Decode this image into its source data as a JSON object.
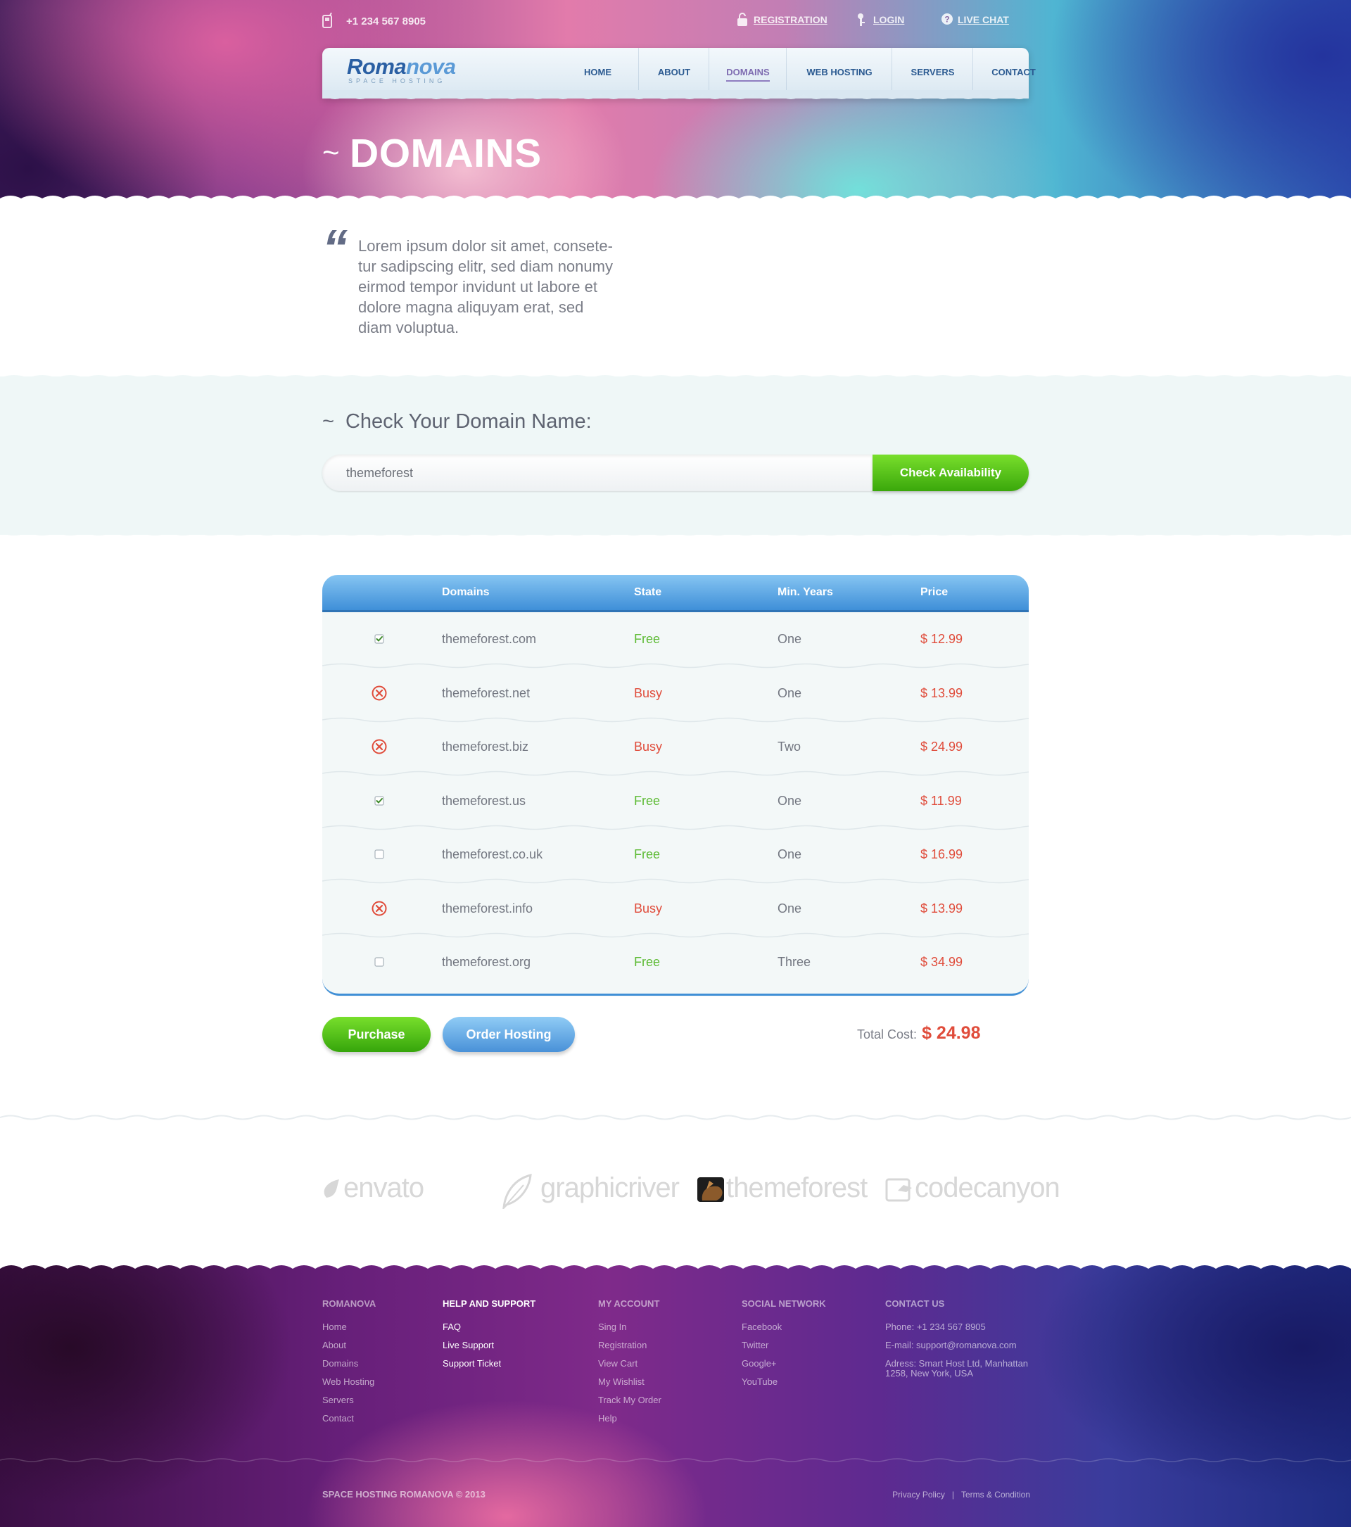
{
  "topbar": {
    "phone": "+1 234 567 8905",
    "links": [
      {
        "label": "REGISTRATION",
        "icon": "lock-icon"
      },
      {
        "label": "LOGIN",
        "icon": "key-icon"
      },
      {
        "label": "LIVE CHAT",
        "icon": "question-icon"
      }
    ]
  },
  "logo": {
    "main_a": "Roma",
    "main_b": "nova",
    "sub": "SPACE HOSTING"
  },
  "nav": [
    "HOME",
    "ABOUT",
    "DOMAINS",
    "WEB HOSTING",
    "SERVERS",
    "CONTACT"
  ],
  "nav_active": "DOMAINS",
  "page": {
    "tilde": "~",
    "title": "DOMAINS"
  },
  "intro": "Lorem ipsum dolor sit amet, consete-tur sadipscing elitr, sed diam nonumy eirmod tempor invidunt ut labore et dolore magna aliquyam erat, sed diam voluptua.",
  "search": {
    "title": "Check Your Domain Name:",
    "value": "themeforest",
    "button": "Check Availability"
  },
  "table": {
    "headers": [
      "Domains",
      "State",
      "Min. Years",
      "Price"
    ],
    "rows": [
      {
        "mark": "checked",
        "domain": "themeforest.com",
        "state": "Free",
        "years": "One",
        "price": "$ 12.99"
      },
      {
        "mark": "busy",
        "domain": "themeforest.net",
        "state": "Busy",
        "years": "One",
        "price": "$ 13.99"
      },
      {
        "mark": "busy",
        "domain": "themeforest.biz",
        "state": "Busy",
        "years": "Two",
        "price": "$ 24.99"
      },
      {
        "mark": "checked",
        "domain": "themeforest.us",
        "state": "Free",
        "years": "One",
        "price": "$ 11.99"
      },
      {
        "mark": "unchecked",
        "domain": "themeforest.co.uk",
        "state": "Free",
        "years": "One",
        "price": "$ 16.99"
      },
      {
        "mark": "busy",
        "domain": "themeforest.info",
        "state": "Busy",
        "years": "One",
        "price": "$ 13.99"
      },
      {
        "mark": "unchecked",
        "domain": "themeforest.org",
        "state": "Free",
        "years": "Three",
        "price": "$ 34.99"
      }
    ]
  },
  "actions": {
    "purchase": "Purchase",
    "order": "Order Hosting",
    "total_label": "Total Cost:",
    "total_value": "$ 24.98"
  },
  "partners": [
    "envato",
    "graphicriver",
    "themeforest",
    "codecanyon"
  ],
  "footer": {
    "columns": [
      {
        "title": "ROMANOVA",
        "links": [
          "Home",
          "About",
          "Domains",
          "Web Hosting",
          "Servers",
          "Contact"
        ]
      },
      {
        "title": "HELP AND SUPPORT",
        "links": [
          "FAQ",
          "Live Support",
          "Support Ticket"
        ]
      },
      {
        "title": "MY ACCOUNT",
        "links": [
          "Sing In",
          "Registration",
          "View Cart",
          "My Wishlist",
          "Track My Order",
          "Help"
        ]
      },
      {
        "title": "SOCIAL NETWORK",
        "links": [
          "Facebook",
          "Twitter",
          "Google+",
          "YouTube"
        ]
      },
      {
        "title": "CONTACT US",
        "links": [
          "Phone: +1 234 567 8905",
          "E-mail: support@romanova.com",
          "Adress: Smart Host Ltd, Manhattan 1258, New York, USA"
        ]
      }
    ],
    "copyright": "SPACE HOSTING ROMANOVA © 2013",
    "legal": [
      "Privacy Policy",
      "Terms & Condition"
    ],
    "legal_sep": "|"
  },
  "colors": {
    "free": "#5dbb35",
    "busy": "#e04c3b",
    "accent_blue": "#3f8fd6",
    "accent_green": "#3aa70b"
  }
}
